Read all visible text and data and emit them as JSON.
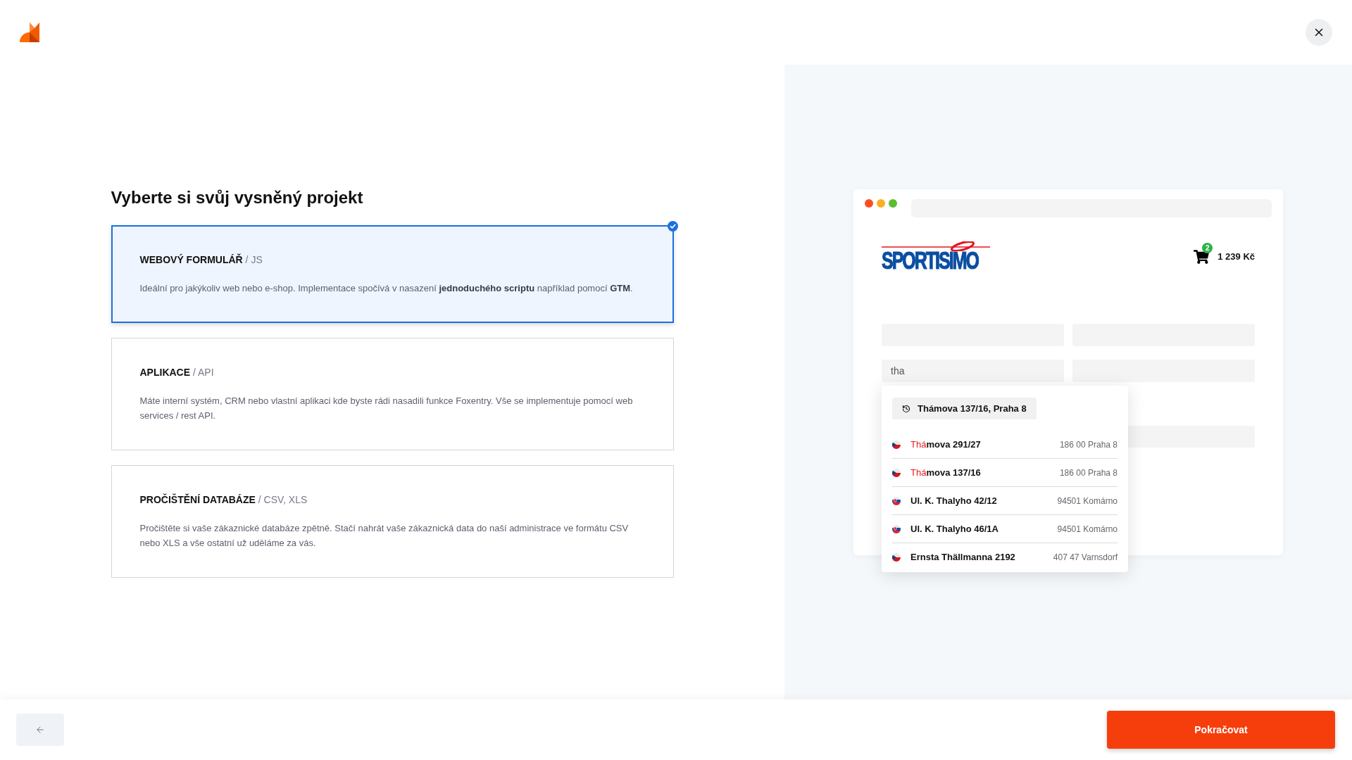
{
  "heading": "Vyberte si svůj vysněný projekt",
  "project_options": [
    {
      "title": "**WEBOVÝ FORMULÁŘ** / JS",
      "description": "Ideální pro jakýkoliv web nebo e-shop. Implementace spočívá v nasazení **jednoduchého scriptu** například pomocí **GTM**.",
      "selected": true
    },
    {
      "title": "**APLIKACE** / API",
      "description": "Máte interní systém, CRM nebo vlastní aplikaci kde byste rádi nasadili funkce Foxentry. Vše se implementuje pomocí web services / rest API.",
      "selected": false
    },
    {
      "title": "**PROČIŠTĚNÍ DATABÁZE** / CSV, XLS",
      "description": "Pročištěte si vaše zákaznické databáze zpětně. Stačí nahrát vaše zákaznická data do naší administrace ve formátu CSV nebo XLS a vše ostatní už uděláme za vás.",
      "selected": false
    }
  ],
  "preview": {
    "shop_logo": "SPORTISIMO",
    "cart": {
      "count": "2",
      "total": "1 239 Kč"
    },
    "address_field": {
      "value": "tha"
    },
    "autocomplete": {
      "recent": "Thámova 137/16, Praha 8",
      "suggestions": [
        {
          "kind": "czech",
          "street_parts": [
            {
              "text": "Thá",
              "highlighted": true
            },
            {
              "text": "mova 291/27",
              "highlighted": false
            }
          ],
          "city": "186 00 Praha 8"
        },
        {
          "kind": "czech",
          "street_parts": [
            {
              "text": "Thá",
              "highlighted": true
            },
            {
              "text": "mova 137/16",
              "highlighted": false
            }
          ],
          "city": "186 00 Praha 8"
        },
        {
          "kind": "slovak",
          "street_parts": [
            {
              "text": "Ul. K. Thalyho 42/12",
              "highlighted": false
            }
          ],
          "city": "94501 Komárno"
        },
        {
          "kind": "slovak",
          "street_parts": [
            {
              "text": "Ul. K. Thalyho 46/1A",
              "highlighted": false
            }
          ],
          "city": "94501 Komárno"
        },
        {
          "kind": "czech",
          "street_parts": [
            {
              "text": "Ernsta Thällmanna 2192",
              "highlighted": false
            }
          ],
          "city": "407 47 Varnsdorf"
        }
      ]
    }
  },
  "footer": {
    "continue_button": "Pokračovat"
  }
}
